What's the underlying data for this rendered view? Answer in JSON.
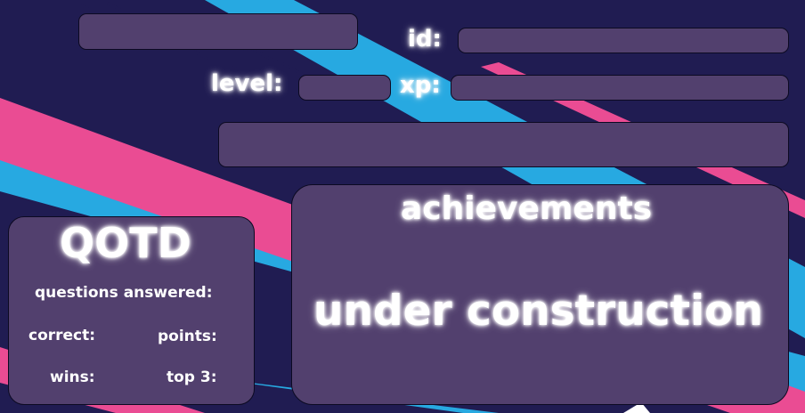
{
  "profile": {
    "name": "",
    "id_label": "id:",
    "id_value": "",
    "level_label": "level:",
    "level_value": "",
    "xp_label": "xp:",
    "xp_value": "",
    "bio": ""
  },
  "qotd": {
    "title": "QOTD",
    "questions_answered_label": "questions answered:",
    "correct_label": "correct:",
    "points_label": "points:",
    "wins_label": "wins:",
    "top3_label": "top 3:"
  },
  "achievements": {
    "title": "achievements",
    "status": "under construction"
  },
  "colors": {
    "background": "#201c52",
    "stripe_blue": "#27a9e1",
    "stripe_pink": "#ea4c93",
    "panel": "#52406e"
  }
}
